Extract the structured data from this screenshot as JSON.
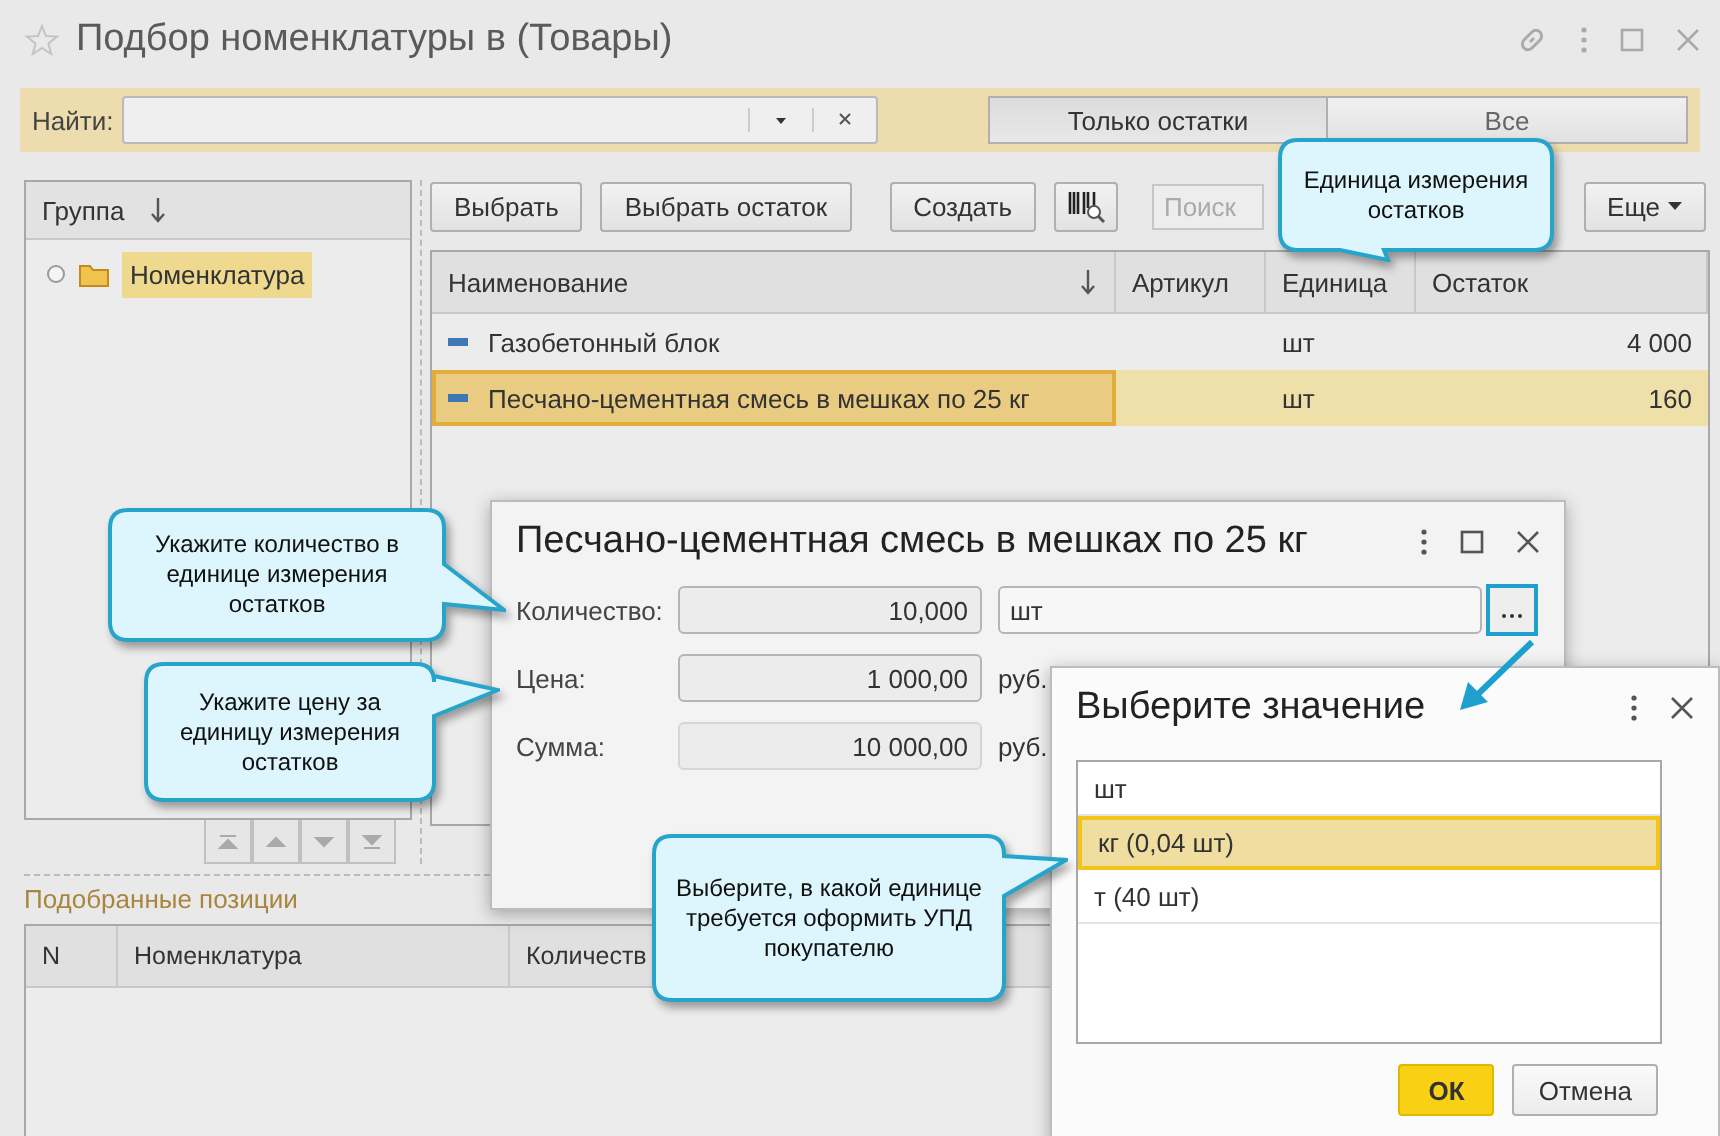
{
  "window": {
    "title": "Подбор номенклатуры в (Товары)"
  },
  "search_bar": {
    "label": "Найти:",
    "buttons": [
      {
        "label": "Только остатки",
        "selected": true
      },
      {
        "label": "Все",
        "selected": false
      }
    ]
  },
  "group_panel": {
    "header": "Группа"
  },
  "tree": [
    {
      "label": "Номенклатура",
      "selected": true
    }
  ],
  "toolbar": {
    "buttons": [
      "Выбрать",
      "Выбрать остаток",
      "Создать"
    ],
    "search": {
      "placeholder": "Поиск"
    },
    "more": "Еще"
  },
  "table": {
    "columns": [
      "Наименование",
      "Артикул",
      "Единица",
      "Остаток"
    ],
    "rows": [
      {
        "name": "Газобетонный блок",
        "unit": "шт",
        "balance": "4 000",
        "selected": false
      },
      {
        "name": "Песчано-цементная смесь в мешках по 25 кг",
        "unit": "шт",
        "balance": "160",
        "selected": true
      }
    ]
  },
  "selected_items": {
    "title": "Подобранные позиции",
    "columns": [
      "N",
      "Номенклатура",
      "Количеств"
    ]
  },
  "item_dialog": {
    "title": "Песчано-цементная смесь в мешках по 25 кг",
    "fields": [
      {
        "label": "Количество:",
        "value": "10,000",
        "unit": "шт",
        "kind": "unit-select"
      },
      {
        "label": "Цена:",
        "value": "1 000,00",
        "unit": "руб.",
        "kind": "editable"
      },
      {
        "label": "Сумма:",
        "value": "10 000,00",
        "unit": "руб.",
        "kind": "readonly"
      }
    ]
  },
  "select_dialog": {
    "title": "Выберите значение",
    "options": [
      {
        "label": "шт",
        "selected": false
      },
      {
        "label": "кг (0,04 шт)",
        "selected": true
      },
      {
        "label": "т (40 шт)",
        "selected": false
      }
    ],
    "buttons": [
      {
        "label": "ОК",
        "primary": true
      },
      {
        "label": "Отмена",
        "primary": false
      }
    ]
  },
  "callouts": [
    "Единица измерения остатков",
    "Укажите количество в единице измерения остатков",
    "Укажите цену за единицу измерения остатков",
    "Выберите, в какой единице требуется оформить УПД покупателю"
  ]
}
